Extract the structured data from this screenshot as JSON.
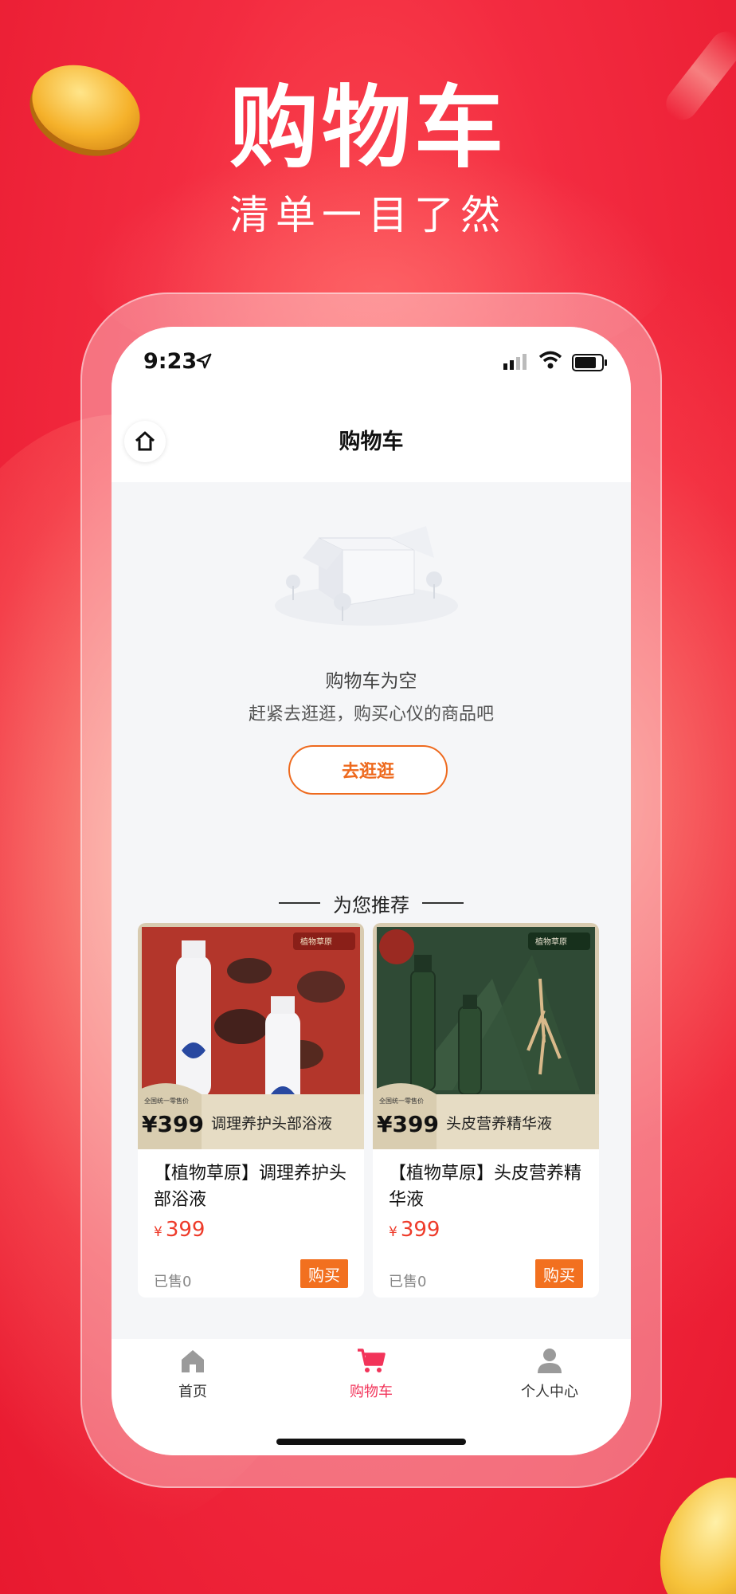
{
  "hero": {
    "title": "购物车",
    "subtitle": "清单一目了然"
  },
  "status_bar": {
    "time": "9:23"
  },
  "nav": {
    "title": "购物车"
  },
  "empty_state": {
    "title": "购物车为空",
    "subtitle": "赶紧去逛逛，购买心仪的商品吧",
    "button": "去逛逛"
  },
  "recommend": {
    "title": "为您推荐",
    "products": [
      {
        "name": "【植物草原】调理养护头部浴液",
        "currency": "¥",
        "price": "399",
        "sold": "已售0",
        "buy": "购买",
        "banner_price": "¥399",
        "banner_tag": "全国统一零售价",
        "banner_text": "调理养护头部浴液",
        "brand": "植物草原",
        "theme_color": "#b3362b"
      },
      {
        "name": "【植物草原】头皮营养精华液",
        "currency": "¥",
        "price": "399",
        "sold": "已售0",
        "buy": "购买",
        "banner_price": "¥399",
        "banner_tag": "全国统一零售价",
        "banner_text": "头皮营养精华液",
        "brand": "植物草原",
        "theme_color": "#2f4a35"
      }
    ]
  },
  "tabbar": {
    "items": [
      {
        "label": "首页",
        "icon": "home-icon"
      },
      {
        "label": "购物车",
        "icon": "cart-icon",
        "active": true
      },
      {
        "label": "个人中心",
        "icon": "user-icon"
      }
    ]
  },
  "colors": {
    "accent": "#ee6a1e",
    "tab_active": "#f2345a",
    "price": "#ee3b2a",
    "background": "#f0263c"
  }
}
